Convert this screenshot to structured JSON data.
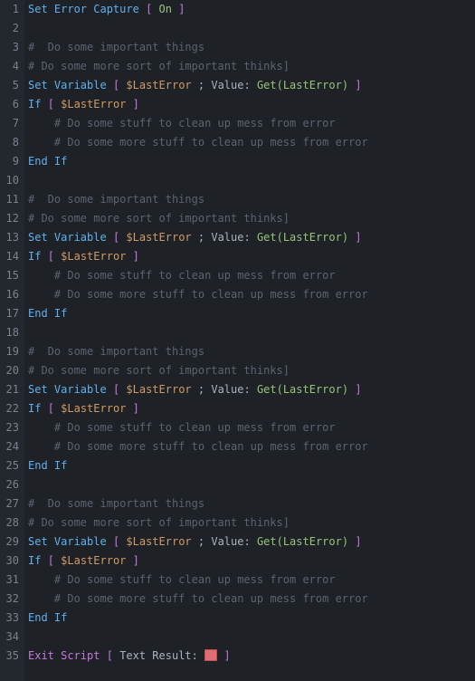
{
  "lines": [
    {
      "n": 1,
      "indent": 0,
      "tokens": [
        {
          "t": "Set Error Capture",
          "c": "cmd"
        },
        {
          "t": " ",
          "c": "text"
        },
        {
          "t": "[",
          "c": "punct"
        },
        {
          "t": " On ",
          "c": "value"
        },
        {
          "t": "]",
          "c": "punct"
        }
      ]
    },
    {
      "n": 2,
      "indent": 0,
      "tokens": []
    },
    {
      "n": 3,
      "indent": 0,
      "tokens": [
        {
          "t": "#  Do some important things",
          "c": "comment"
        }
      ]
    },
    {
      "n": 4,
      "indent": 0,
      "tokens": [
        {
          "t": "# Do some more sort of important thinks]",
          "c": "comment"
        }
      ]
    },
    {
      "n": 5,
      "indent": 0,
      "tokens": [
        {
          "t": "Set Variable",
          "c": "cmd"
        },
        {
          "t": " ",
          "c": "text"
        },
        {
          "t": "[",
          "c": "punct"
        },
        {
          "t": " ",
          "c": "text"
        },
        {
          "t": "$LastError",
          "c": "var"
        },
        {
          "t": " ; ",
          "c": "text"
        },
        {
          "t": "Value:",
          "c": "text"
        },
        {
          "t": " ",
          "c": "text"
        },
        {
          "t": "Get(LastError)",
          "c": "value"
        },
        {
          "t": " ",
          "c": "text"
        },
        {
          "t": "]",
          "c": "punct"
        }
      ]
    },
    {
      "n": 6,
      "indent": 0,
      "tokens": [
        {
          "t": "If",
          "c": "keyword"
        },
        {
          "t": " ",
          "c": "text"
        },
        {
          "t": "[",
          "c": "punct"
        },
        {
          "t": " ",
          "c": "text"
        },
        {
          "t": "$LastError",
          "c": "var"
        },
        {
          "t": " ",
          "c": "text"
        },
        {
          "t": "]",
          "c": "punct"
        }
      ]
    },
    {
      "n": 7,
      "indent": 1,
      "tokens": [
        {
          "t": "# Do some stuff to clean up mess from error",
          "c": "comment"
        }
      ]
    },
    {
      "n": 8,
      "indent": 1,
      "tokens": [
        {
          "t": "# Do some more stuff to clean up mess from error",
          "c": "comment"
        }
      ]
    },
    {
      "n": 9,
      "indent": 0,
      "tokens": [
        {
          "t": "End If",
          "c": "keyword"
        }
      ]
    },
    {
      "n": 10,
      "indent": 0,
      "tokens": []
    },
    {
      "n": 11,
      "indent": 0,
      "tokens": [
        {
          "t": "#  Do some important things",
          "c": "comment"
        }
      ]
    },
    {
      "n": 12,
      "indent": 0,
      "tokens": [
        {
          "t": "# Do some more sort of important thinks]",
          "c": "comment"
        }
      ]
    },
    {
      "n": 13,
      "indent": 0,
      "tokens": [
        {
          "t": "Set Variable",
          "c": "cmd"
        },
        {
          "t": " ",
          "c": "text"
        },
        {
          "t": "[",
          "c": "punct"
        },
        {
          "t": " ",
          "c": "text"
        },
        {
          "t": "$LastError",
          "c": "var"
        },
        {
          "t": " ; ",
          "c": "text"
        },
        {
          "t": "Value:",
          "c": "text"
        },
        {
          "t": " ",
          "c": "text"
        },
        {
          "t": "Get(LastError)",
          "c": "value"
        },
        {
          "t": " ",
          "c": "text"
        },
        {
          "t": "]",
          "c": "punct"
        }
      ]
    },
    {
      "n": 14,
      "indent": 0,
      "tokens": [
        {
          "t": "If",
          "c": "keyword"
        },
        {
          "t": " ",
          "c": "text"
        },
        {
          "t": "[",
          "c": "punct"
        },
        {
          "t": " ",
          "c": "text"
        },
        {
          "t": "$LastError",
          "c": "var"
        },
        {
          "t": " ",
          "c": "text"
        },
        {
          "t": "]",
          "c": "punct"
        }
      ]
    },
    {
      "n": 15,
      "indent": 1,
      "tokens": [
        {
          "t": "# Do some stuff to clean up mess from error",
          "c": "comment"
        }
      ]
    },
    {
      "n": 16,
      "indent": 1,
      "tokens": [
        {
          "t": "# Do some more stuff to clean up mess from error",
          "c": "comment"
        }
      ]
    },
    {
      "n": 17,
      "indent": 0,
      "tokens": [
        {
          "t": "End If",
          "c": "keyword"
        }
      ]
    },
    {
      "n": 18,
      "indent": 0,
      "tokens": []
    },
    {
      "n": 19,
      "indent": 0,
      "tokens": [
        {
          "t": "#  Do some important things",
          "c": "comment"
        }
      ]
    },
    {
      "n": 20,
      "indent": 0,
      "tokens": [
        {
          "t": "# Do some more sort of important thinks]",
          "c": "comment"
        }
      ]
    },
    {
      "n": 21,
      "indent": 0,
      "tokens": [
        {
          "t": "Set Variable",
          "c": "cmd"
        },
        {
          "t": " ",
          "c": "text"
        },
        {
          "t": "[",
          "c": "punct"
        },
        {
          "t": " ",
          "c": "text"
        },
        {
          "t": "$LastError",
          "c": "var"
        },
        {
          "t": " ; ",
          "c": "text"
        },
        {
          "t": "Value:",
          "c": "text"
        },
        {
          "t": " ",
          "c": "text"
        },
        {
          "t": "Get(LastError)",
          "c": "value"
        },
        {
          "t": " ",
          "c": "text"
        },
        {
          "t": "]",
          "c": "punct"
        }
      ]
    },
    {
      "n": 22,
      "indent": 0,
      "tokens": [
        {
          "t": "If",
          "c": "keyword"
        },
        {
          "t": " ",
          "c": "text"
        },
        {
          "t": "[",
          "c": "punct"
        },
        {
          "t": " ",
          "c": "text"
        },
        {
          "t": "$LastError",
          "c": "var"
        },
        {
          "t": " ",
          "c": "text"
        },
        {
          "t": "]",
          "c": "punct"
        }
      ]
    },
    {
      "n": 23,
      "indent": 1,
      "tokens": [
        {
          "t": "# Do some stuff to clean up mess from error",
          "c": "comment"
        }
      ]
    },
    {
      "n": 24,
      "indent": 1,
      "tokens": [
        {
          "t": "# Do some more stuff to clean up mess from error",
          "c": "comment"
        }
      ]
    },
    {
      "n": 25,
      "indent": 0,
      "tokens": [
        {
          "t": "End If",
          "c": "keyword"
        }
      ]
    },
    {
      "n": 26,
      "indent": 0,
      "tokens": []
    },
    {
      "n": 27,
      "indent": 0,
      "tokens": [
        {
          "t": "#  Do some important things",
          "c": "comment"
        }
      ]
    },
    {
      "n": 28,
      "indent": 0,
      "tokens": [
        {
          "t": "# Do some more sort of important thinks]",
          "c": "comment"
        }
      ]
    },
    {
      "n": 29,
      "indent": 0,
      "tokens": [
        {
          "t": "Set Variable",
          "c": "cmd"
        },
        {
          "t": " ",
          "c": "text"
        },
        {
          "t": "[",
          "c": "punct"
        },
        {
          "t": " ",
          "c": "text"
        },
        {
          "t": "$LastError",
          "c": "var"
        },
        {
          "t": " ; ",
          "c": "text"
        },
        {
          "t": "Value:",
          "c": "text"
        },
        {
          "t": " ",
          "c": "text"
        },
        {
          "t": "Get(LastError)",
          "c": "value"
        },
        {
          "t": " ",
          "c": "text"
        },
        {
          "t": "]",
          "c": "punct"
        }
      ]
    },
    {
      "n": 30,
      "indent": 0,
      "tokens": [
        {
          "t": "If",
          "c": "keyword"
        },
        {
          "t": " ",
          "c": "text"
        },
        {
          "t": "[",
          "c": "punct"
        },
        {
          "t": " ",
          "c": "text"
        },
        {
          "t": "$LastError",
          "c": "var"
        },
        {
          "t": " ",
          "c": "text"
        },
        {
          "t": "]",
          "c": "punct"
        }
      ]
    },
    {
      "n": 31,
      "indent": 1,
      "tokens": [
        {
          "t": "# Do some stuff to clean up mess from error",
          "c": "comment"
        }
      ]
    },
    {
      "n": 32,
      "indent": 1,
      "tokens": [
        {
          "t": "# Do some more stuff to clean up mess from error",
          "c": "comment"
        }
      ]
    },
    {
      "n": 33,
      "indent": 0,
      "tokens": [
        {
          "t": "End If",
          "c": "keyword"
        }
      ]
    },
    {
      "n": 34,
      "indent": 0,
      "tokens": []
    },
    {
      "n": 35,
      "indent": 0,
      "tokens": [
        {
          "t": "Exit Script",
          "c": "exit"
        },
        {
          "t": " ",
          "c": "text"
        },
        {
          "t": "[",
          "c": "punct"
        },
        {
          "t": " ",
          "c": "text"
        },
        {
          "t": "Text Result:",
          "c": "text"
        },
        {
          "t": " ",
          "c": "text"
        },
        {
          "t": "",
          "c": "pill"
        },
        {
          "t": " ",
          "c": "text"
        },
        {
          "t": "]",
          "c": "punct"
        }
      ]
    }
  ]
}
